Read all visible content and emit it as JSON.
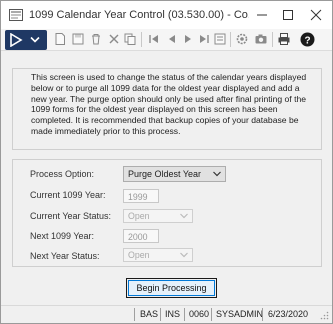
{
  "window": {
    "title": "1099 Calendar Year Control (03.530.00) - Co..."
  },
  "toolbar": {
    "icons": [
      "new-icon",
      "save-icon",
      "delete-icon",
      "cancel-icon",
      "copy-icon",
      "first-icon",
      "previous-icon",
      "next-icon",
      "last-icon",
      "settings-icon",
      "view-icon",
      "print-icon",
      "help-icon"
    ]
  },
  "info": {
    "text": "This screen is used to change the status of the calendar years displayed below or to purge all 1099 data for the oldest year displayed and add a new year.  The purge option should only be used after final printing of the 1099 forms for the oldest year displayed on this screen has been completed.  It is recommended that backup copies of your database be made immediately prior to this process."
  },
  "form": {
    "process_option_label": "Process Option:",
    "process_option_value": "Purge Oldest Year",
    "current_year_label": "Current 1099 Year:",
    "current_year_value": "1999",
    "current_status_label": "Current Year Status:",
    "current_status_value": "Open",
    "next_year_label": "Next 1099 Year:",
    "next_year_value": "2000",
    "next_status_label": "Next Year Status:",
    "next_status_value": "Open"
  },
  "actions": {
    "begin_label": "Begin Processing"
  },
  "status": {
    "module": "BAS",
    "mode": "INS",
    "company": "0060",
    "user": "SYSADMIN",
    "date": "6/23/2020"
  },
  "colors": {
    "menu_button": "#1f3864",
    "accent": "#0078d7"
  }
}
